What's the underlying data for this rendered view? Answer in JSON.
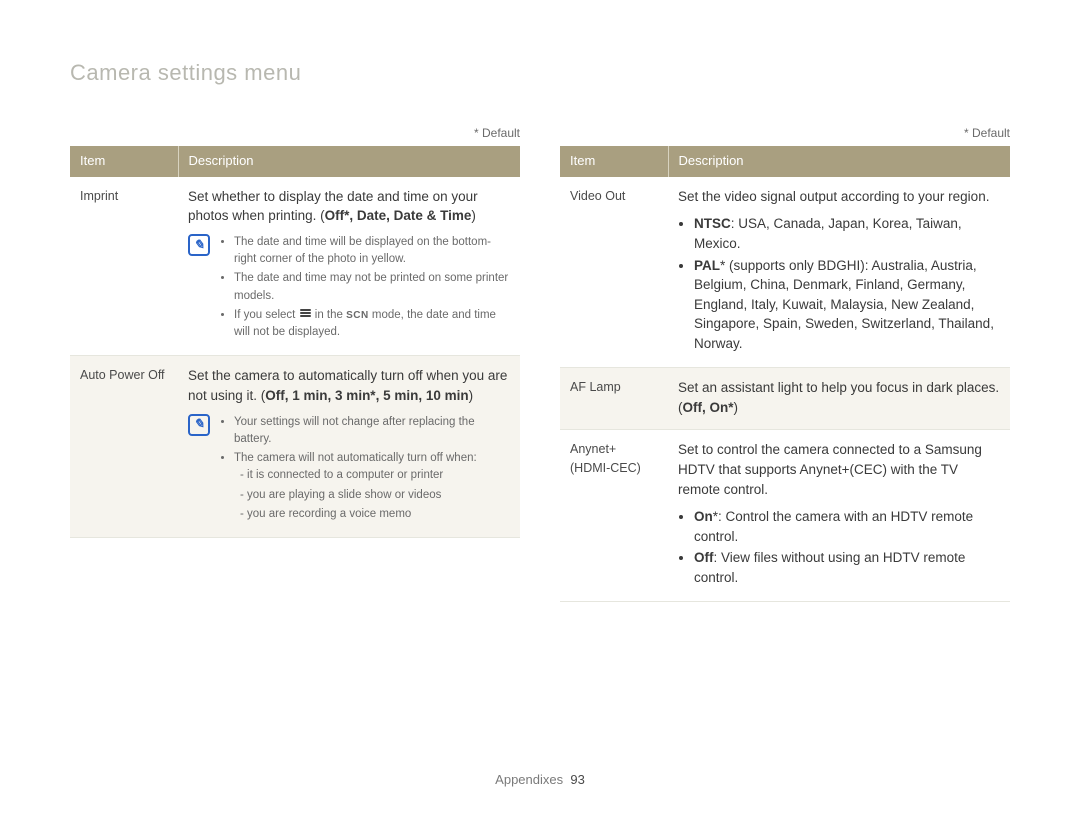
{
  "page": {
    "title": "Camera settings menu",
    "footer_label": "Appendixes",
    "page_number": "93"
  },
  "default_label": "* Default",
  "headers": {
    "item": "Item",
    "description": "Description"
  },
  "left": {
    "rows": [
      {
        "item": "Imprint",
        "main_pre": "Set whether to display the date and time on your photos when printing. (",
        "options": "Off*, Date, Date & Time",
        "main_post": ")",
        "notes": [
          "The date and time will be displayed on the bottom-right corner of the photo in yellow.",
          "The date and time may not be printed on some printer models.",
          "If you select __MENUICON__ in the __SCN__ mode, the date and time will not be displayed."
        ]
      },
      {
        "item": "Auto Power Off",
        "main_pre": "Set the camera to automatically turn off when you are not using it. (",
        "options": "Off, 1 min, 3 min*, 5 min, 10 min",
        "main_post": ")",
        "notes": [
          "Your settings will not change after replacing the battery.",
          "The camera will not automatically turn off when:"
        ],
        "sublist": [
          "it is connected to a computer or printer",
          "you are playing a slide show or videos",
          "you are recording a voice memo"
        ]
      }
    ]
  },
  "right": {
    "rows": [
      {
        "item": "Video Out",
        "main": "Set the video signal output according to your region.",
        "bullets": [
          {
            "bold": "NTSC",
            "text": ": USA, Canada, Japan, Korea, Taiwan, Mexico."
          },
          {
            "bold": "PAL",
            "suffix": "* (supports only BDGHI)",
            "text": ": Australia, Austria, Belgium, China, Denmark, Finland, Germany, England, Italy, Kuwait, Malaysia, New Zealand, Singapore, Spain, Sweden, Switzerland, Thailand, Norway."
          }
        ]
      },
      {
        "item": "AF Lamp",
        "main_pre": "Set an assistant light to help you focus in dark places. (",
        "options": "Off, On*",
        "main_post": ")"
      },
      {
        "item": "Anynet+ (HDMI-CEC)",
        "main": "Set to control the camera connected to a Samsung HDTV that supports Anynet+(CEC) with the TV remote control.",
        "bullets": [
          {
            "bold": "On",
            "suffix": "*",
            "text": ": Control the camera with an HDTV remote control."
          },
          {
            "bold": "Off",
            "text": ": View files without using an HDTV remote control."
          }
        ]
      }
    ]
  }
}
